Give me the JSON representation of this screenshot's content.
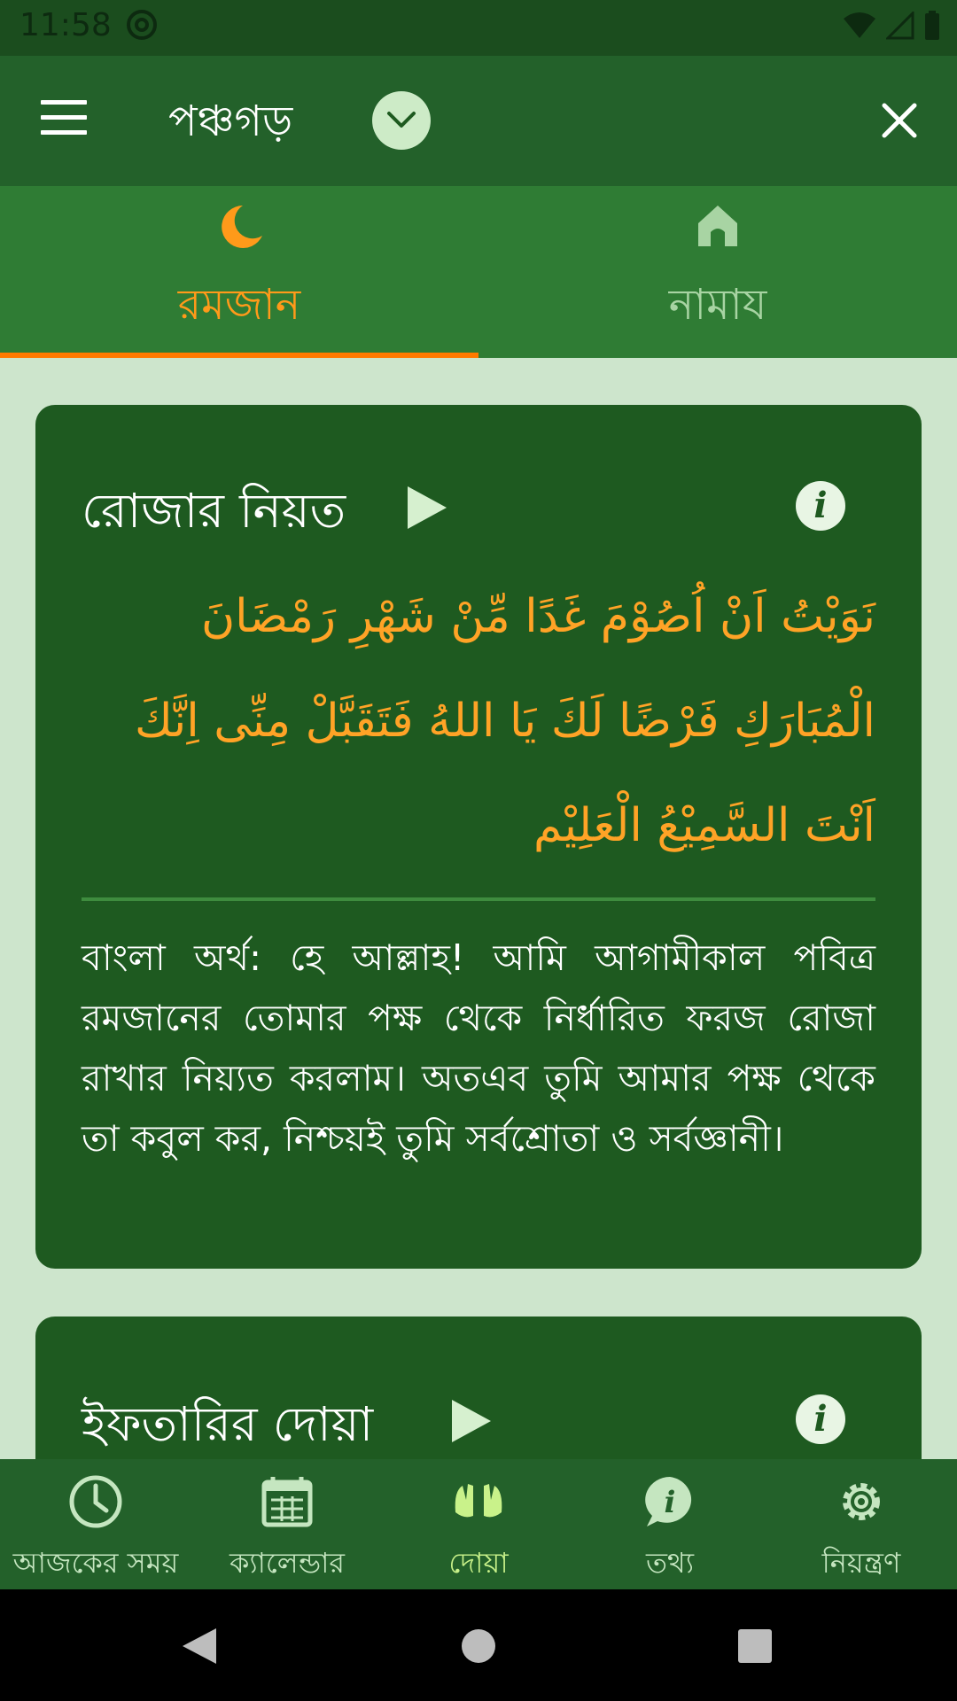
{
  "status_bar": {
    "time": "11:58"
  },
  "app_bar": {
    "location": "পঞ্চগড়"
  },
  "tabs": [
    {
      "label": "রমজান",
      "icon": "crescent-moon-icon",
      "active": true
    },
    {
      "label": "নামায",
      "icon": "mosque-icon",
      "active": false
    }
  ],
  "cards": [
    {
      "title": "রোজার নিয়ত",
      "arabic": "نَوَيْتُ اَنْ اُصُوْمَ غَدًا مِّنْ شَهْرِ رَمْضَانَ الْمُبَارَكِ فَرْضًا لَكَ يَا اللهُ فَتَقَبَّلْ مِنِّى اِنَّكَ اَنْتَ السَّمِيْعُ الْعَلِيْم",
      "meaning": "বাংলা অর্থ: হে আল্লাহ! আমি আগামীকাল পবিত্র রমজানের তোমার পক্ষ থেকে নির্ধারিত ফরজ রোজা রাখার নিয়্যত করলাম। অতএব তুমি আমার পক্ষ থেকে তা কবুল কর, নিশ্চয়ই তুমি সর্বশ্রোতা ও সর্বজ্ঞানী।"
    },
    {
      "title": "ইফতারির দোয়া"
    }
  ],
  "bottom_nav": [
    {
      "label": "আজকের সময়",
      "icon": "clock-icon"
    },
    {
      "label": "ক্যালেন্ডার",
      "icon": "calendar-icon"
    },
    {
      "label": "দোয়া",
      "icon": "praying-hands-icon",
      "active": true
    },
    {
      "label": "তথ্য",
      "icon": "info-bubble-icon"
    },
    {
      "label": "নিয়ন্ত্রণ",
      "icon": "gear-icon"
    }
  ],
  "colors": {
    "primary": "#23612a",
    "tab_bar": "#2f7c34",
    "accent": "#ff9a1a",
    "card": "#1e5a20",
    "background": "#cde5cc",
    "active_nav": "#c9f28a"
  }
}
